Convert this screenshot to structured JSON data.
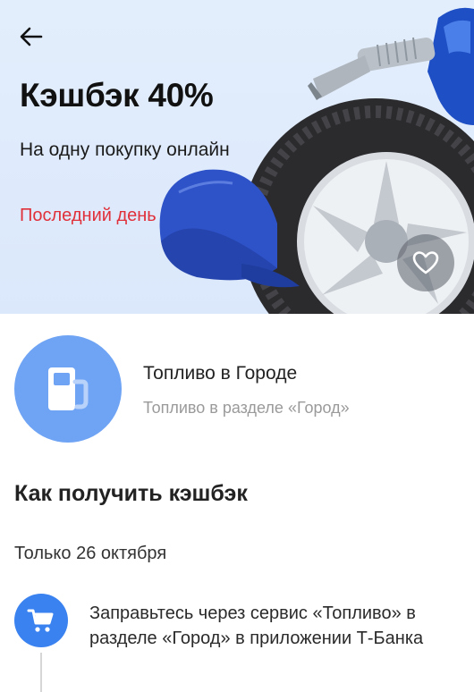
{
  "hero": {
    "title": "Кэшбэк 40%",
    "subtitle": "На одну покупку онлайн",
    "deadline": "Последний день"
  },
  "partner": {
    "name": "Топливо в Городе",
    "subtitle": "Топливо в разделе «Город»",
    "icon": "fuel-pump-icon"
  },
  "how_to": {
    "title": "Как получить кэшбэк",
    "date": "Только 26 октября",
    "steps": [
      {
        "icon": "shopping-cart-icon",
        "text": "Заправьтесь через сервис «Топливо» в разделе «Город» в приложении Т-Банка"
      }
    ]
  },
  "colors": {
    "accent": "#3a82f0",
    "partner_circle": "#6fa4f5",
    "warning": "#e0303a",
    "hero_bg": "#dde9fb"
  }
}
